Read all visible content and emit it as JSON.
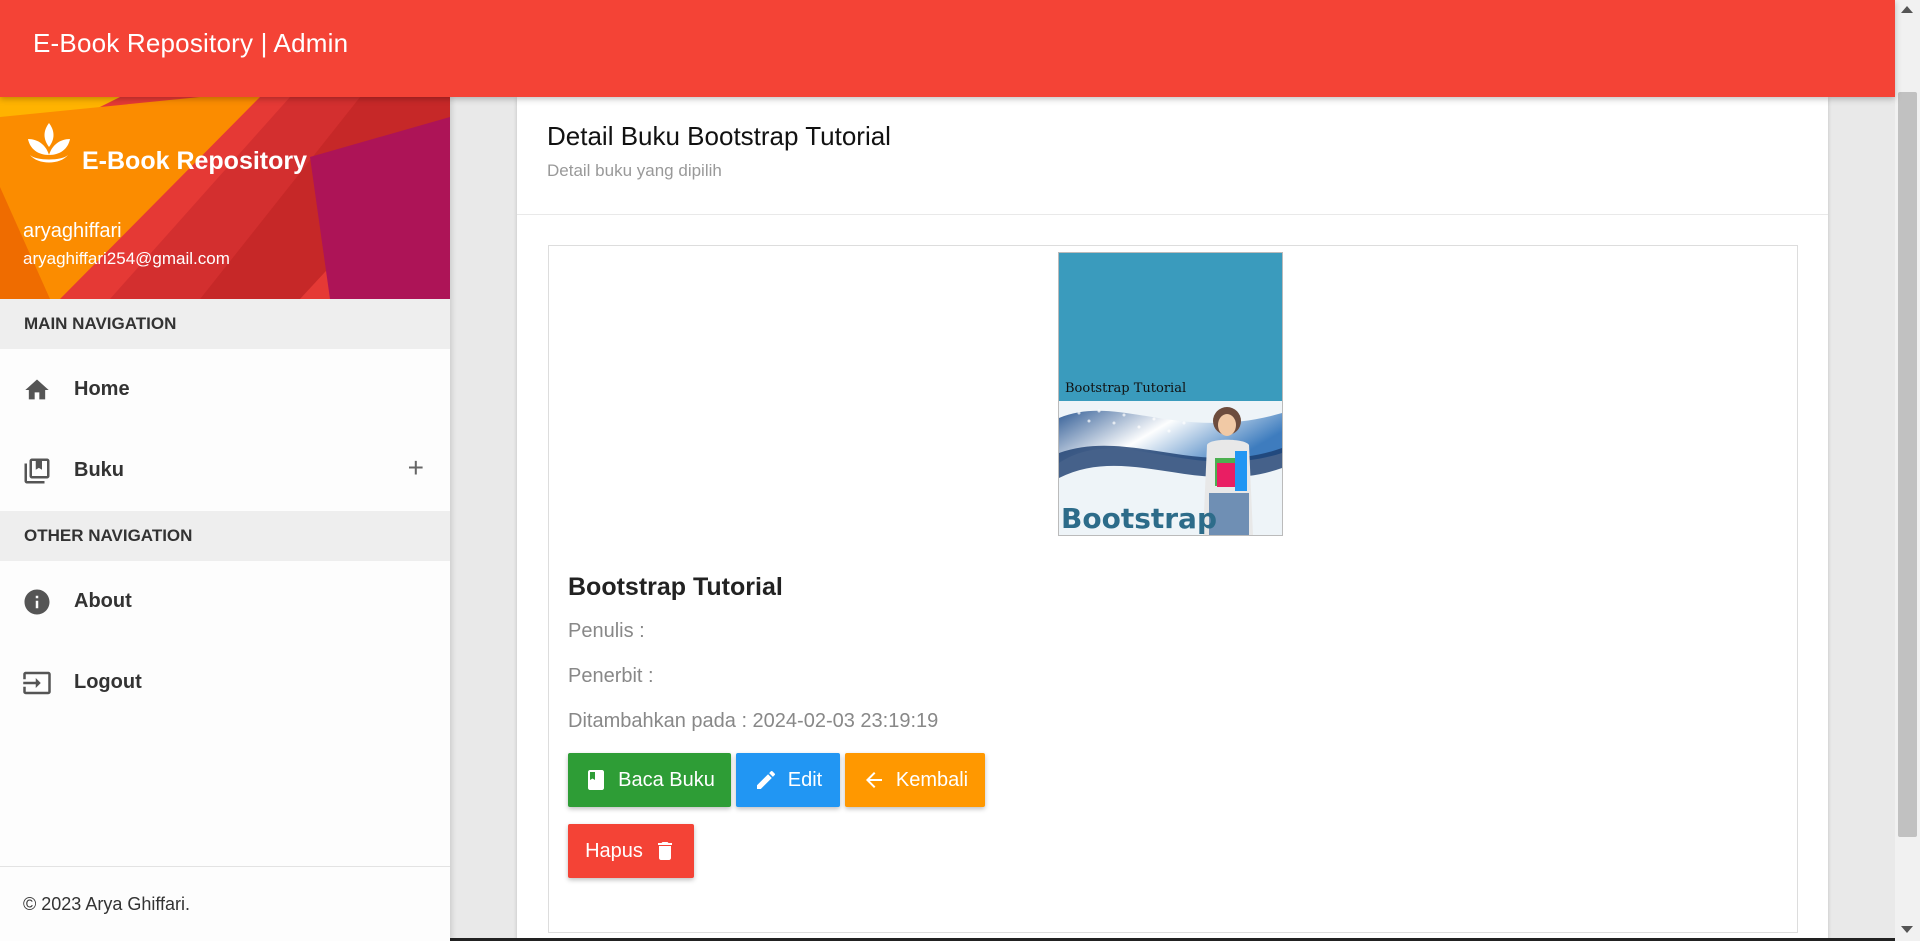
{
  "navbar": {
    "title": "E-Book Repository | Admin"
  },
  "sidebar": {
    "site_name": "E-Book Repository",
    "username": "aryaghiffari",
    "email": "aryaghiffari254@gmail.com",
    "main_header": "MAIN NAVIGATION",
    "other_header": "OTHER NAVIGATION",
    "items": [
      {
        "label": "Home",
        "icon": "home-icon"
      },
      {
        "label": "Buku",
        "icon": "library-books-icon",
        "expand": "+"
      },
      {
        "label": "About",
        "icon": "info-icon"
      },
      {
        "label": "Logout",
        "icon": "logout-icon"
      }
    ],
    "footer": "© 2023 Arya Ghiffari."
  },
  "main": {
    "title": "Detail Buku Bootstrap Tutorial",
    "subtitle": "Detail buku yang dipilih",
    "cover": {
      "caption": "Bootstrap Tutorial",
      "word": "Bootstrap"
    },
    "book_title": "Bootstrap Tutorial",
    "penulis": "Penulis :",
    "penerbit": "Penerbit :",
    "ditambahkan": "Ditambahkan pada : 2024-02-03 23:19:19",
    "buttons": {
      "read": "Baca Buku",
      "edit": "Edit",
      "back": "Kembali",
      "delete": "Hapus"
    }
  },
  "colors": {
    "primary": "#f44336",
    "green": "#2e9d36",
    "blue": "#2196f3",
    "orange": "#ff9800"
  }
}
